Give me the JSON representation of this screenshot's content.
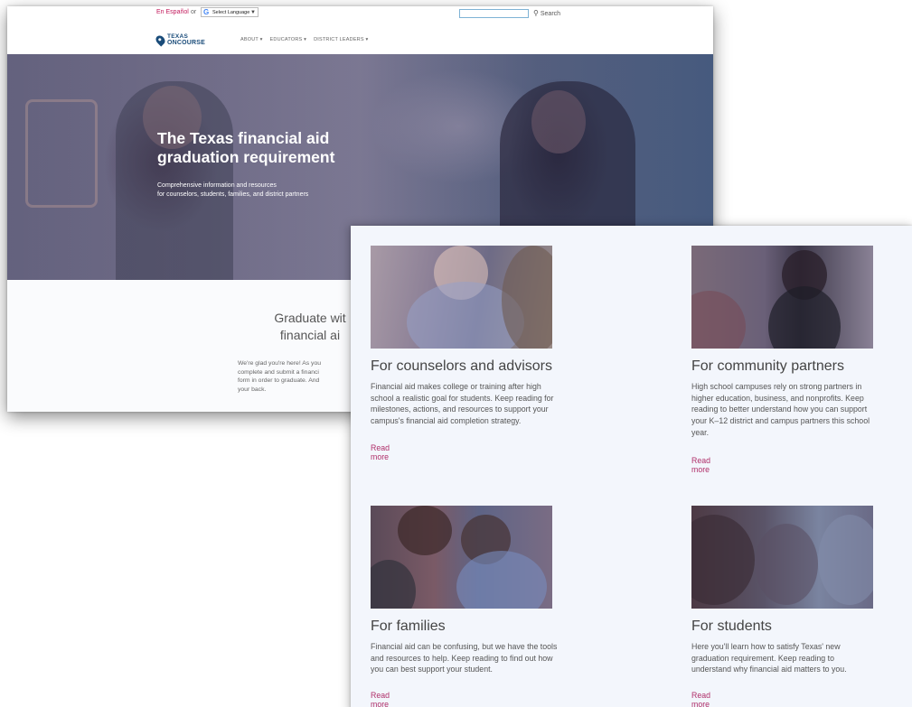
{
  "back_window": {
    "topbar": {
      "lang_spanish": "En Español",
      "lang_or": "or",
      "lang_select_label": "Select Language",
      "search_button": "Search"
    },
    "logo": {
      "line1": "TEXAS",
      "line2": "ONCOURSE"
    },
    "nav": [
      {
        "label": "ABOUT ▾"
      },
      {
        "label": "EDUCATORS ▾"
      },
      {
        "label": "DISTRICT LEADERS ▾"
      }
    ],
    "hero": {
      "title": "The Texas financial aid graduation requirement",
      "subtitle_line1": "Comprehensive information and resources",
      "subtitle_line2": "for counselors, students, families, and district partners"
    },
    "section": {
      "title_line1": "Graduate wit",
      "title_line2": "financial ai",
      "text_lines": [
        "We're glad you're here! As you",
        "complete and submit a financi",
        "form in order to graduate. And",
        "your back."
      ]
    }
  },
  "cards": [
    {
      "title": "For counselors and advisors",
      "text_lines": [
        "Financial aid makes college or training after high",
        "school a realistic goal for students. Keep reading for",
        "milestones, actions, and resources to support your",
        "campus's financial aid completion strategy."
      ],
      "link": "Read more"
    },
    {
      "title": "For community partners",
      "text_lines": [
        "High school campuses rely on strong partners in",
        "higher education, business, and nonprofits. Keep",
        "reading to better understand how you can support",
        "your K–12 district and campus partners this school",
        "year."
      ],
      "link": "Read more"
    },
    {
      "title": "For families",
      "text_lines": [
        "Financial aid can be confusing, but we have the tools",
        "and resources to help. Keep reading to find out how",
        "you can best support your student."
      ],
      "link": "Read more"
    },
    {
      "title": "For students",
      "text_lines": [
        "Here you'll learn how to satisfy Texas' new",
        "graduation requirement. Keep reading to",
        "understand why financial aid matters to you."
      ],
      "link": "Read more"
    }
  ],
  "colors": {
    "brand_navy": "#1a4c7a",
    "link_magenta": "#b0306a",
    "page_bg_light": "#f3f6fc"
  }
}
